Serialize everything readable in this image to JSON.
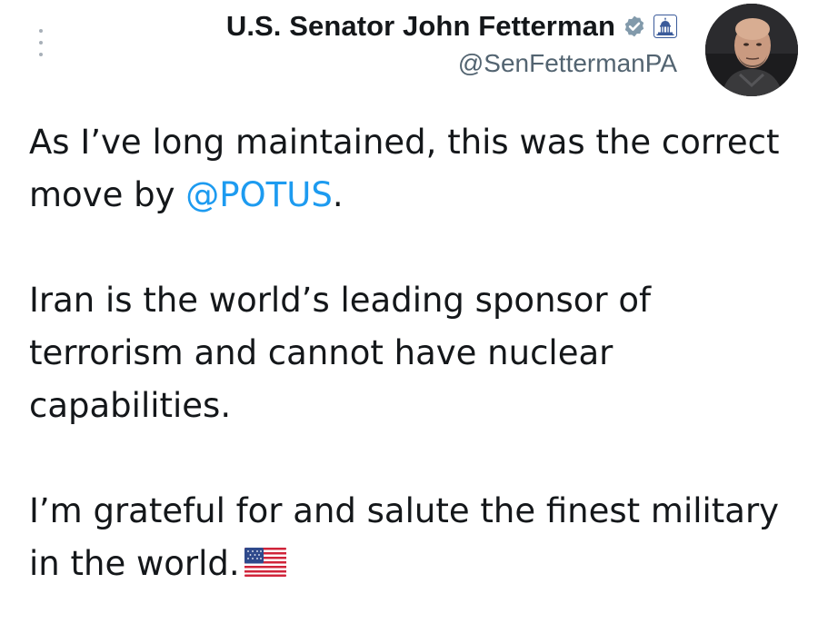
{
  "author": {
    "display_name": "U.S. Senator John Fetterman",
    "handle": "@SenFettermanPA",
    "icons": {
      "verified": "verified-badge-icon",
      "affiliation": "capitol-building-icon"
    },
    "avatar": "profile-photo"
  },
  "tweet": {
    "p1_before": "As I’ve long maintained, this was the correct move by ",
    "p1_mention": "@POTUS",
    "p1_after": ".",
    "p2": "Iran is the world’s leading sponsor of terrorism and cannot have nuclear capabilities.",
    "p3": "I’m grateful for and salute the finest military in the world.",
    "p3_emoji": "us-flag-emoji"
  },
  "colors": {
    "text": "#14171a",
    "secondary": "#536471",
    "link": "#1d9bf0",
    "verified_badge": "#829aab"
  }
}
